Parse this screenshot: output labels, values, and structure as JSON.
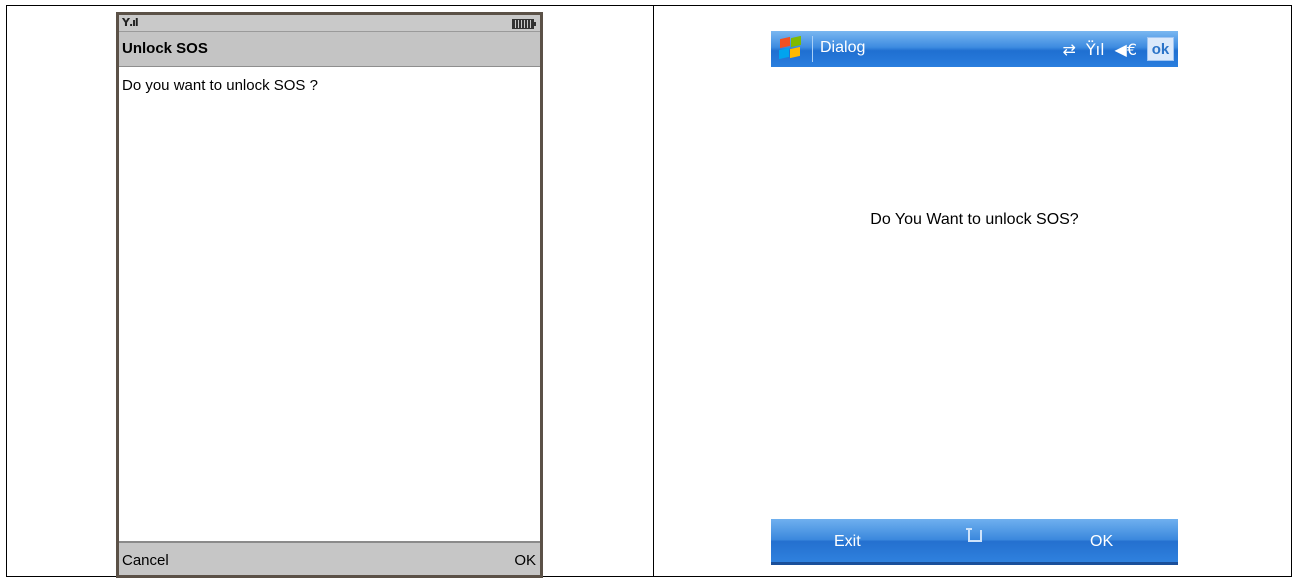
{
  "left_screen": {
    "title": "Unlock SOS",
    "message": "Do you want to unlock SOS ?",
    "softkey_left": "Cancel",
    "softkey_right": "OK",
    "icons": {
      "signal": "signal-strength-icon",
      "battery": "battery-icon"
    }
  },
  "right_screen": {
    "title": "Dialog",
    "message": "Do You Want to unlock SOS?",
    "ok_button": "ok",
    "menu_left": "Exit",
    "menu_right": "OK",
    "icons": {
      "start": "windows-start-icon",
      "connectivity": "connectivity-icon",
      "signal": "signal-icon",
      "volume": "speaker-icon",
      "keyboard": "input-panel-icon"
    }
  },
  "colors": {
    "j2me_frame": "#5b5147",
    "j2me_bar": "#c4c4c4",
    "wm_blue": "#2a7ede"
  }
}
